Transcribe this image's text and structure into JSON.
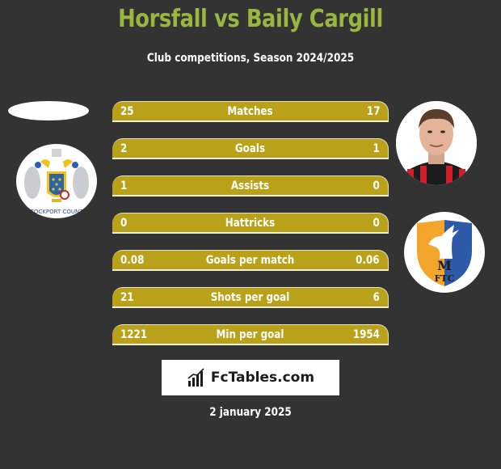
{
  "header": {
    "title": "Horsfall vs Baily Cargill",
    "subtitle": "Club competitions, Season 2024/2025"
  },
  "colors": {
    "background": "#333333",
    "title": "#98b640",
    "bar": "#b9a21a",
    "bar_border": "#f2eedc"
  },
  "players": {
    "left": {
      "name": "Horsfall",
      "club_logo": "stockport-county-crest"
    },
    "right": {
      "name": "Baily Cargill",
      "photo": "player-photo",
      "club_logo": "mansfield-town-crest"
    }
  },
  "stats": [
    {
      "label": "Matches",
      "left": "25",
      "right": "17"
    },
    {
      "label": "Goals",
      "left": "2",
      "right": "1"
    },
    {
      "label": "Assists",
      "left": "1",
      "right": "0"
    },
    {
      "label": "Hattricks",
      "left": "0",
      "right": "0"
    },
    {
      "label": "Goals per match",
      "left": "0.08",
      "right": "0.06"
    },
    {
      "label": "Shots per goal",
      "left": "21",
      "right": "6"
    },
    {
      "label": "Min per goal",
      "left": "1221",
      "right": "1954"
    }
  ],
  "logos": {
    "left_crest_text": "STOCKPORT COUNTY",
    "right_crest_text": "MTFC"
  },
  "brand": {
    "name": "FcTables.com",
    "icon": "bar-chart-icon"
  },
  "footer": {
    "date": "2 january 2025"
  }
}
